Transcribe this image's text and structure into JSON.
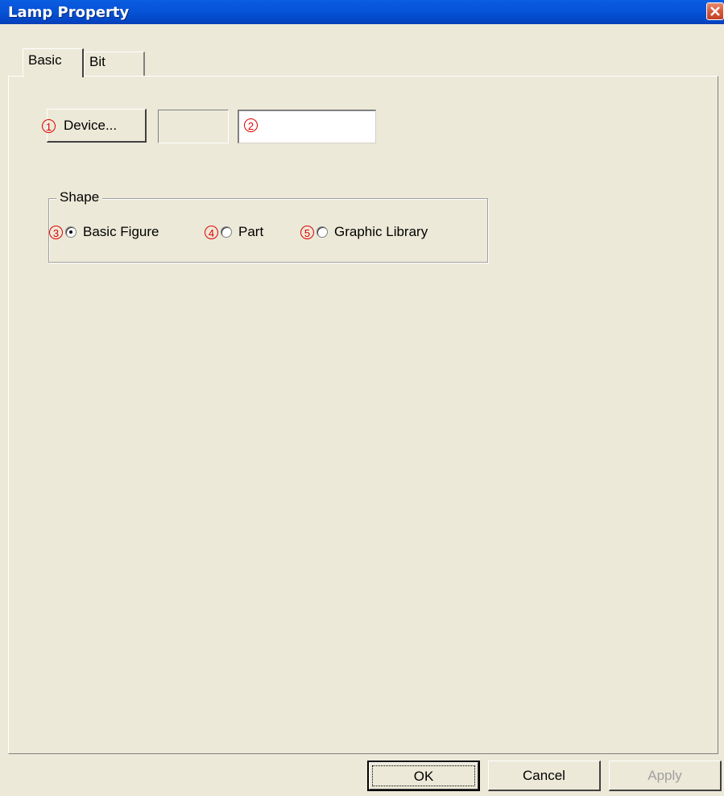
{
  "window": {
    "title": "Lamp Property"
  },
  "tabs": [
    {
      "label": "Basic",
      "selected": true
    },
    {
      "label": "Bit",
      "selected": false
    }
  ],
  "device": {
    "button_label": "Device...",
    "marker": "1",
    "display_value": "",
    "input_value": "",
    "input_marker": "2"
  },
  "shape": {
    "legend": "Shape",
    "options": [
      {
        "marker": "3",
        "label": "Basic Figure",
        "checked": true
      },
      {
        "marker": "4",
        "label": "Part",
        "checked": false
      },
      {
        "marker": "5",
        "label": "Graphic Library",
        "checked": false
      }
    ]
  },
  "buttons": {
    "ok": "OK",
    "cancel": "Cancel",
    "apply": "Apply"
  },
  "colors": {
    "titlebar": "#0553d6",
    "annotation": "#e00000",
    "face": "#ECE9D8"
  }
}
